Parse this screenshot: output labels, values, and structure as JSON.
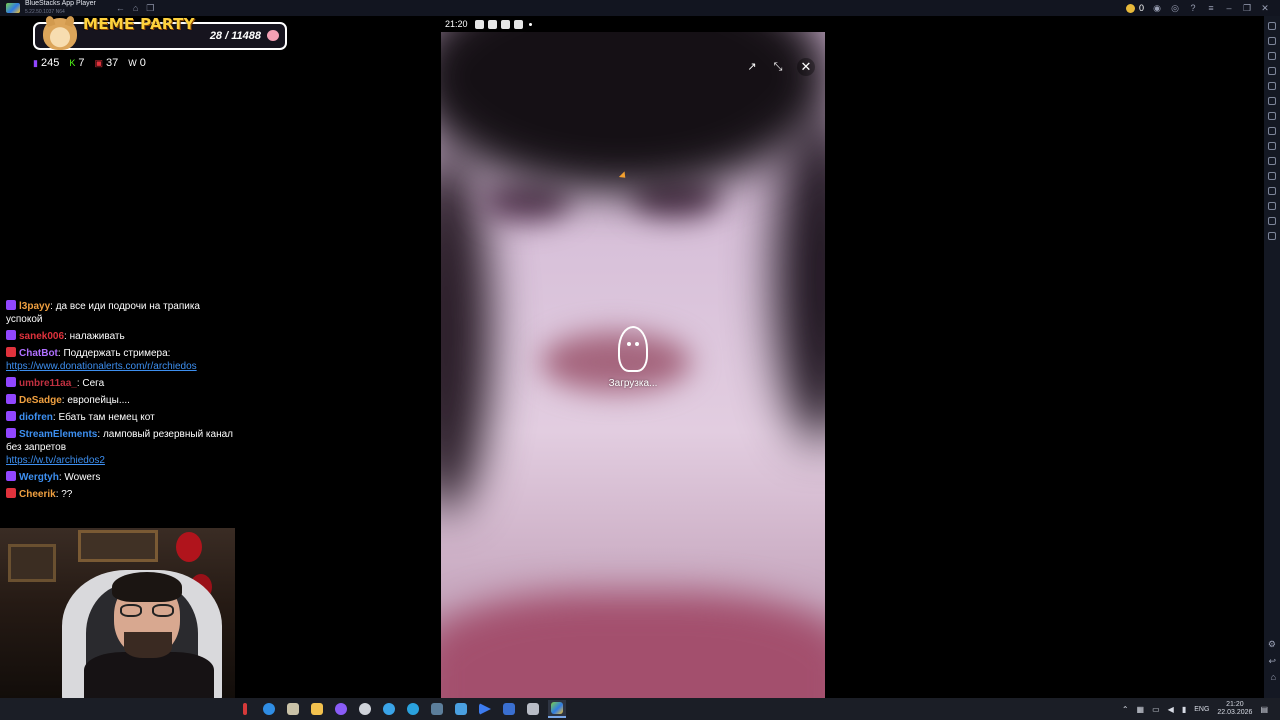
{
  "window": {
    "app_title": "BlueStacks App Player",
    "app_subtitle": "5.22.50.1037 N64",
    "coins": "0"
  },
  "widget": {
    "title": "MEME PARTY",
    "count": "28 / 11488"
  },
  "stats": [
    {
      "icon": "twitch-icon",
      "value": "245"
    },
    {
      "icon": "kick-icon",
      "value": "7"
    },
    {
      "icon": "vk-live-icon",
      "value": "37"
    },
    {
      "icon": "w-icon",
      "value": "0"
    }
  ],
  "chat": [
    {
      "badge": "twitch",
      "user": "l3payy",
      "user_color": "#f0a040",
      "text": "да все иди подрочи на трапика успокой"
    },
    {
      "badge": "twitch",
      "user": "sanek006",
      "user_color": "#e0323c",
      "text": "налаживать"
    },
    {
      "badge": "live",
      "user": "ChatBot",
      "user_color": "#b070ff",
      "text": "Поддержать стримера:",
      "link": "https://www.donationalerts.com/r/archiedos"
    },
    {
      "badge": "twitch",
      "user": "umbre11aa_",
      "user_color": "#c03040",
      "text": "Сега"
    },
    {
      "badge": "twitch",
      "user": "DeSadge",
      "user_color": "#f0a040",
      "text": "европейцы...."
    },
    {
      "badge": "twitch",
      "user": "diofren",
      "user_color": "#3d8ff0",
      "text": "Ебать там немец кот"
    },
    {
      "badge": "twitch",
      "user": "StreamElements",
      "user_color": "#3d8ff0",
      "text": "ламповый резервный канал без запретов",
      "link": "https://w.tv/archiedos2"
    },
    {
      "badge": "twitch",
      "user": "Wergtyh",
      "user_color": "#3d8ff0",
      "text": "Wowers"
    },
    {
      "badge": "live",
      "user": "Cheerik",
      "user_color": "#f0a040",
      "text": "??"
    }
  ],
  "phone": {
    "time": "21:20",
    "loading_text": "Загрузка..."
  },
  "taskbar": {
    "lang": "ENG",
    "time": "21:20",
    "date": "22.03.2026"
  }
}
